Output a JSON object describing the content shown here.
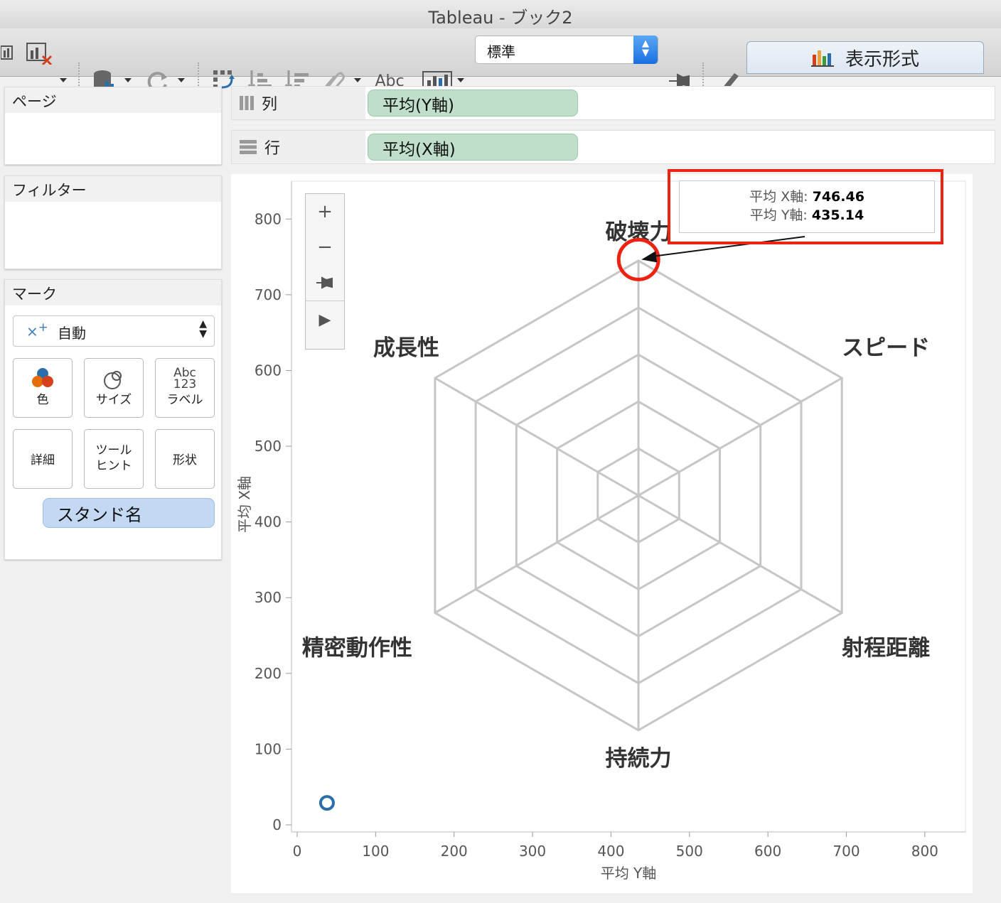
{
  "window": {
    "title": "Tableau - ブック2"
  },
  "toolbar": {
    "abc_label": "Abc",
    "fit_select": "標準",
    "showme_label": "表示形式",
    "icons": [
      "chart-clear-icon",
      "datasource-icon",
      "refresh-icon",
      "swap-icon",
      "sort-asc-icon",
      "sort-desc-icon",
      "attach-icon",
      "label-abc-icon",
      "presentation-icon",
      "pin-icon",
      "highlight-icon",
      "showme-chart-icon"
    ]
  },
  "sidebar": {
    "pages_title": "ページ",
    "filters_title": "フィルター",
    "marks_title": "マーク",
    "mark_type": "自動",
    "mark_buttons": {
      "color": "色",
      "size": "サイズ",
      "label": "ラベル",
      "label_glyph_top": "Abc",
      "label_glyph_bottom": "123",
      "detail": "詳細",
      "tooltip_l1": "ツール",
      "tooltip_l2": "ヒント",
      "shape": "形状"
    },
    "field_pill": "スタンド名"
  },
  "shelves": {
    "columns_label": "列",
    "columns_pill": "平均(Y軸)",
    "rows_label": "行",
    "rows_pill": "平均(X軸)"
  },
  "tooltip": {
    "x_label": "平均 X軸:",
    "x_value": "746.46",
    "y_label": "平均 Y軸:",
    "y_value": "435.14"
  },
  "colors": {
    "highlight_red": "#ee2211",
    "mark_blue": "#2a6fab",
    "pill_green": "#c0dfcb",
    "pill_blue": "#c3d9f3"
  },
  "chart_data": {
    "type": "scatter",
    "xlabel": "平均 Y軸",
    "ylabel": "平均 X軸",
    "xlim": [
      0,
      850
    ],
    "ylim": [
      0,
      850
    ],
    "x_ticks": [
      0,
      100,
      200,
      300,
      400,
      500,
      600,
      700,
      800
    ],
    "y_ticks": [
      0,
      100,
      200,
      300,
      400,
      500,
      600,
      700,
      800
    ],
    "points": [
      {
        "x": 38,
        "y": 29
      }
    ],
    "highlighted_point": {
      "x": 435.14,
      "y": 746.46
    },
    "background_image": {
      "kind": "hexagon radar",
      "center": [
        435,
        435
      ],
      "outer_radius": 310,
      "rings": 5,
      "axis_labels": [
        "破壊力",
        "スピード",
        "射程距離",
        "持続力",
        "精密動作性",
        "成長性"
      ]
    }
  }
}
